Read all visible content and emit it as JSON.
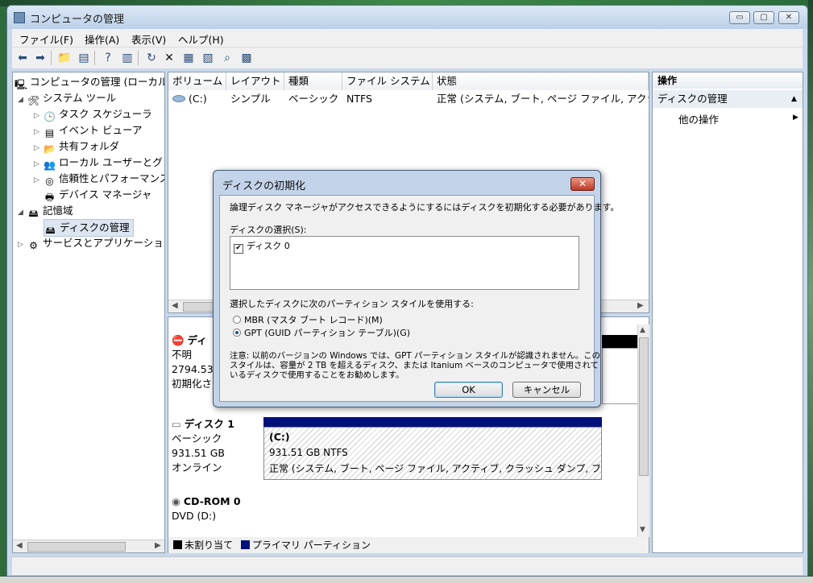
{
  "window": {
    "title": "コンピュータの管理",
    "min": "▭",
    "max": "▢",
    "close": "✕"
  },
  "menu": [
    "ファイル(F)",
    "操作(A)",
    "表示(V)",
    "ヘルプ(H)"
  ],
  "tree": {
    "root": "コンピュータの管理 (ローカル",
    "system_tools": "システム ツール",
    "task_scheduler": "タスク スケジューラ",
    "event_viewer": "イベント ビューア",
    "shared_folders": "共有フォルダ",
    "local_users": "ローカル ユーザーとグ",
    "reliability": "信頼性とパフォーマンス",
    "device_manager": "デバイス マネージャ",
    "storage": "記憶域",
    "disk_management": "ディスクの管理",
    "services": "サービスとアプリケーショ"
  },
  "volumes": {
    "columns": [
      "ボリューム",
      "レイアウト",
      "種類",
      "ファイル システム",
      "状態"
    ],
    "rows": [
      [
        "(C:)",
        "シンプル",
        "ベーシック",
        "NTFS",
        "正常 (システム, ブート, ページ ファイル, アクラ"
      ]
    ]
  },
  "disks": {
    "disk0": {
      "name": "ディ",
      "type": "不明",
      "size": "2794.53",
      "status": "初期化さ"
    },
    "disk1": {
      "name": "ディスク 1",
      "type": "ベーシック",
      "size": "931.51 GB",
      "status": "オンライン",
      "part_label": "(C:)",
      "part_size": "931.51 GB NTFS",
      "part_status": "正常 (システム, ブート, ページ ファイル, アクティブ, クラッシュ ダンプ, プ"
    },
    "cdrom0": {
      "name": "CD-ROM 0",
      "type": "DVD (D:)"
    }
  },
  "legend": {
    "unallocated": "未割り当て",
    "primary": "プライマリ パーティション"
  },
  "actions": {
    "header": "操作",
    "section": "ディスクの管理",
    "other": "他の操作"
  },
  "dialog": {
    "title": "ディスクの初期化",
    "intro": "論理ディスク マネージャがアクセスできるようにするにはディスクを初期化する必要があります。",
    "select_label": "ディスクの選択(S):",
    "disk_item": "ディスク 0",
    "style_label": "選択したディスクに次のパーティション スタイルを使用する:",
    "mbr": "MBR (マスタ ブート レコード)(M)",
    "gpt": "GPT (GUID パーティション テーブル)(G)",
    "note1": "注意: 以前のバージョンの Windows では、GPT パーティション スタイルが認識されません。この",
    "note2": "スタイルは、容量が 2 TB を超えるディスク、または Itanium ベースのコンピュータで使用されて",
    "note3": "いるディスクで使用することをお勧めします。",
    "ok": "OK",
    "cancel": "キャンセル"
  },
  "colors": {
    "primary_partition": "#00107a",
    "unallocated": "#000000",
    "dialog_frame": "#c3d4ea"
  }
}
